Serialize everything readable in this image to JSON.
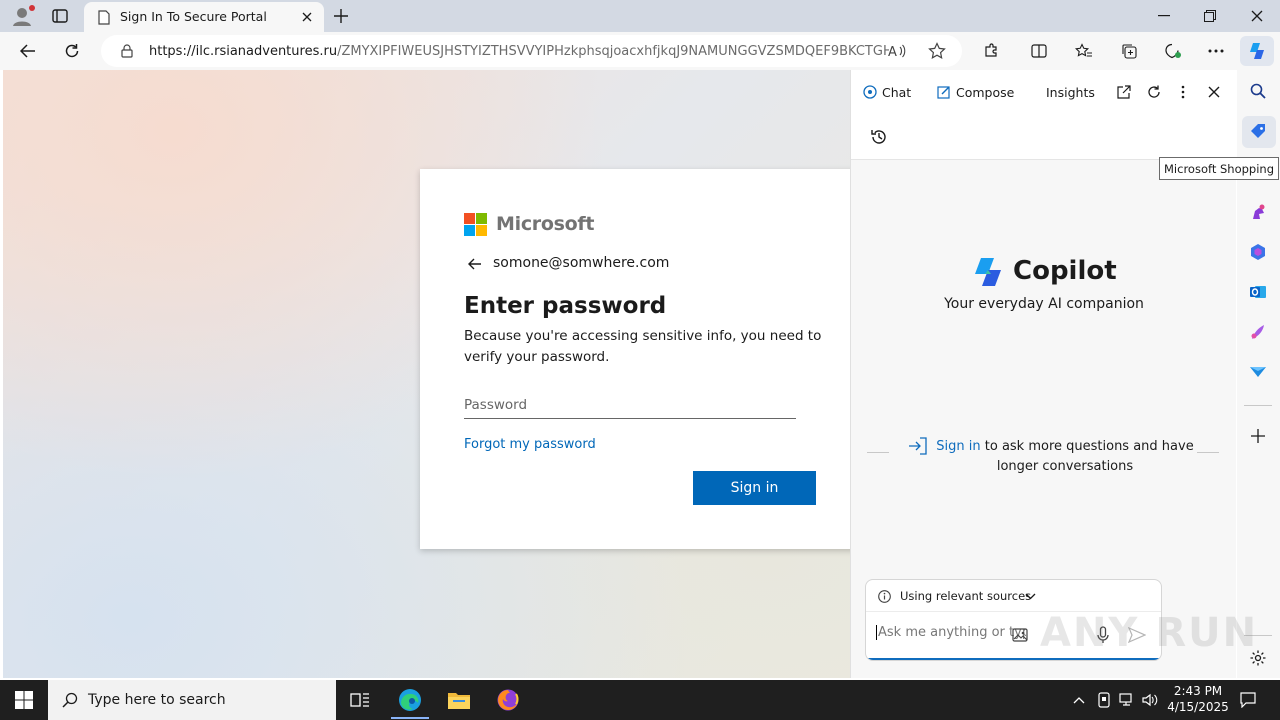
{
  "browser": {
    "tab_title": "Sign In To Secure Portal",
    "url_host": "https://ilc.rsianadventures.ru",
    "url_rest": "/ZMYXIPFIWEUSJHSTYIZTHSVVYIPHzkphsqjoacxhfjkqJ9NAMUNGGVZSMDQEF9BKCTGH..."
  },
  "login": {
    "brand": "Microsoft",
    "identity": "somone@somwhere.com",
    "heading": "Enter password",
    "description": "Because you're accessing sensitive info, you need to verify your password.",
    "password_placeholder": "Password",
    "forgot": "Forgot my password",
    "signin_button": "Sign in"
  },
  "copilot": {
    "tabs": [
      "Chat",
      "Compose",
      "Insights"
    ],
    "title": "Copilot",
    "subtitle": "Your everyday AI companion",
    "signin_link": "Sign in",
    "signin_rest": " to ask more questions and have longer conversations",
    "sources_label": "Using relevant sources",
    "input_placeholder": "Ask me anything or type \"@\""
  },
  "sidebar": {
    "tooltip": "Microsoft Shopping"
  },
  "watermark": "ANY RUN",
  "taskbar": {
    "search_placeholder": "Type here to search",
    "time": "2:43 PM",
    "date": "4/15/2025"
  },
  "colors": {
    "accent": "#0067b8",
    "copilot_link": "#0f6cbd",
    "taskbar": "#1f1f1f"
  }
}
